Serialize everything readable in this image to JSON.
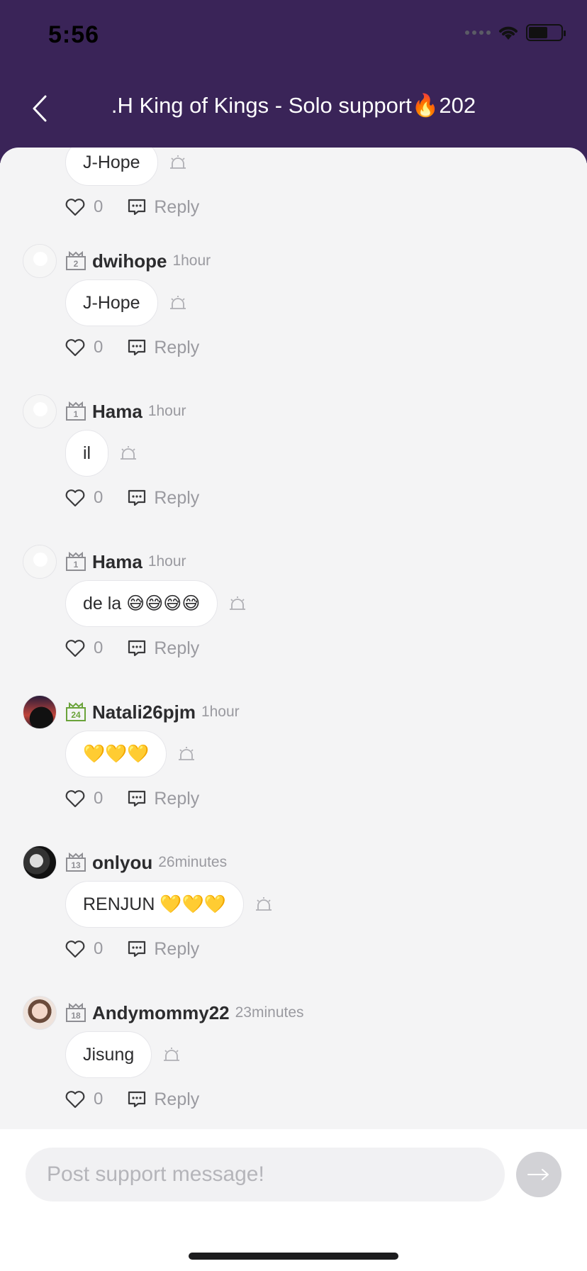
{
  "status_bar": {
    "time": "5:56"
  },
  "header": {
    "title": ".H King of Kings - Solo support🔥202"
  },
  "partial_comment": {
    "message": "J-Hope",
    "likes": "0",
    "reply_label": "Reply"
  },
  "comments": [
    {
      "username": "dwihope",
      "time": "1hour",
      "level": "2",
      "message": "J-Hope",
      "likes": "0",
      "reply_label": "Reply"
    },
    {
      "username": "Hama",
      "time": "1hour",
      "level": "1",
      "message": "il",
      "likes": "0",
      "reply_label": "Reply"
    },
    {
      "username": "Hama",
      "time": "1hour",
      "level": "1",
      "message": "de la 😅😅😅😅",
      "likes": "0",
      "reply_label": "Reply"
    },
    {
      "username": "Natali26pjm",
      "time": "1hour",
      "level": "24",
      "message": "💛💛💛",
      "likes": "0",
      "reply_label": "Reply"
    },
    {
      "username": "onlyou",
      "time": "26minutes",
      "level": "13",
      "message": "RENJUN 💛💛💛",
      "likes": "0",
      "reply_label": "Reply"
    },
    {
      "username": "Andymommy22",
      "time": "23minutes",
      "level": "18",
      "message": "Jisung",
      "likes": "0",
      "reply_label": "Reply"
    }
  ],
  "footer": {
    "input_placeholder": "Post support message!"
  },
  "colors": {
    "header_bg": "#3a2458",
    "badge_gray": "#8e8e93",
    "badge_green": "#6aa33a"
  }
}
